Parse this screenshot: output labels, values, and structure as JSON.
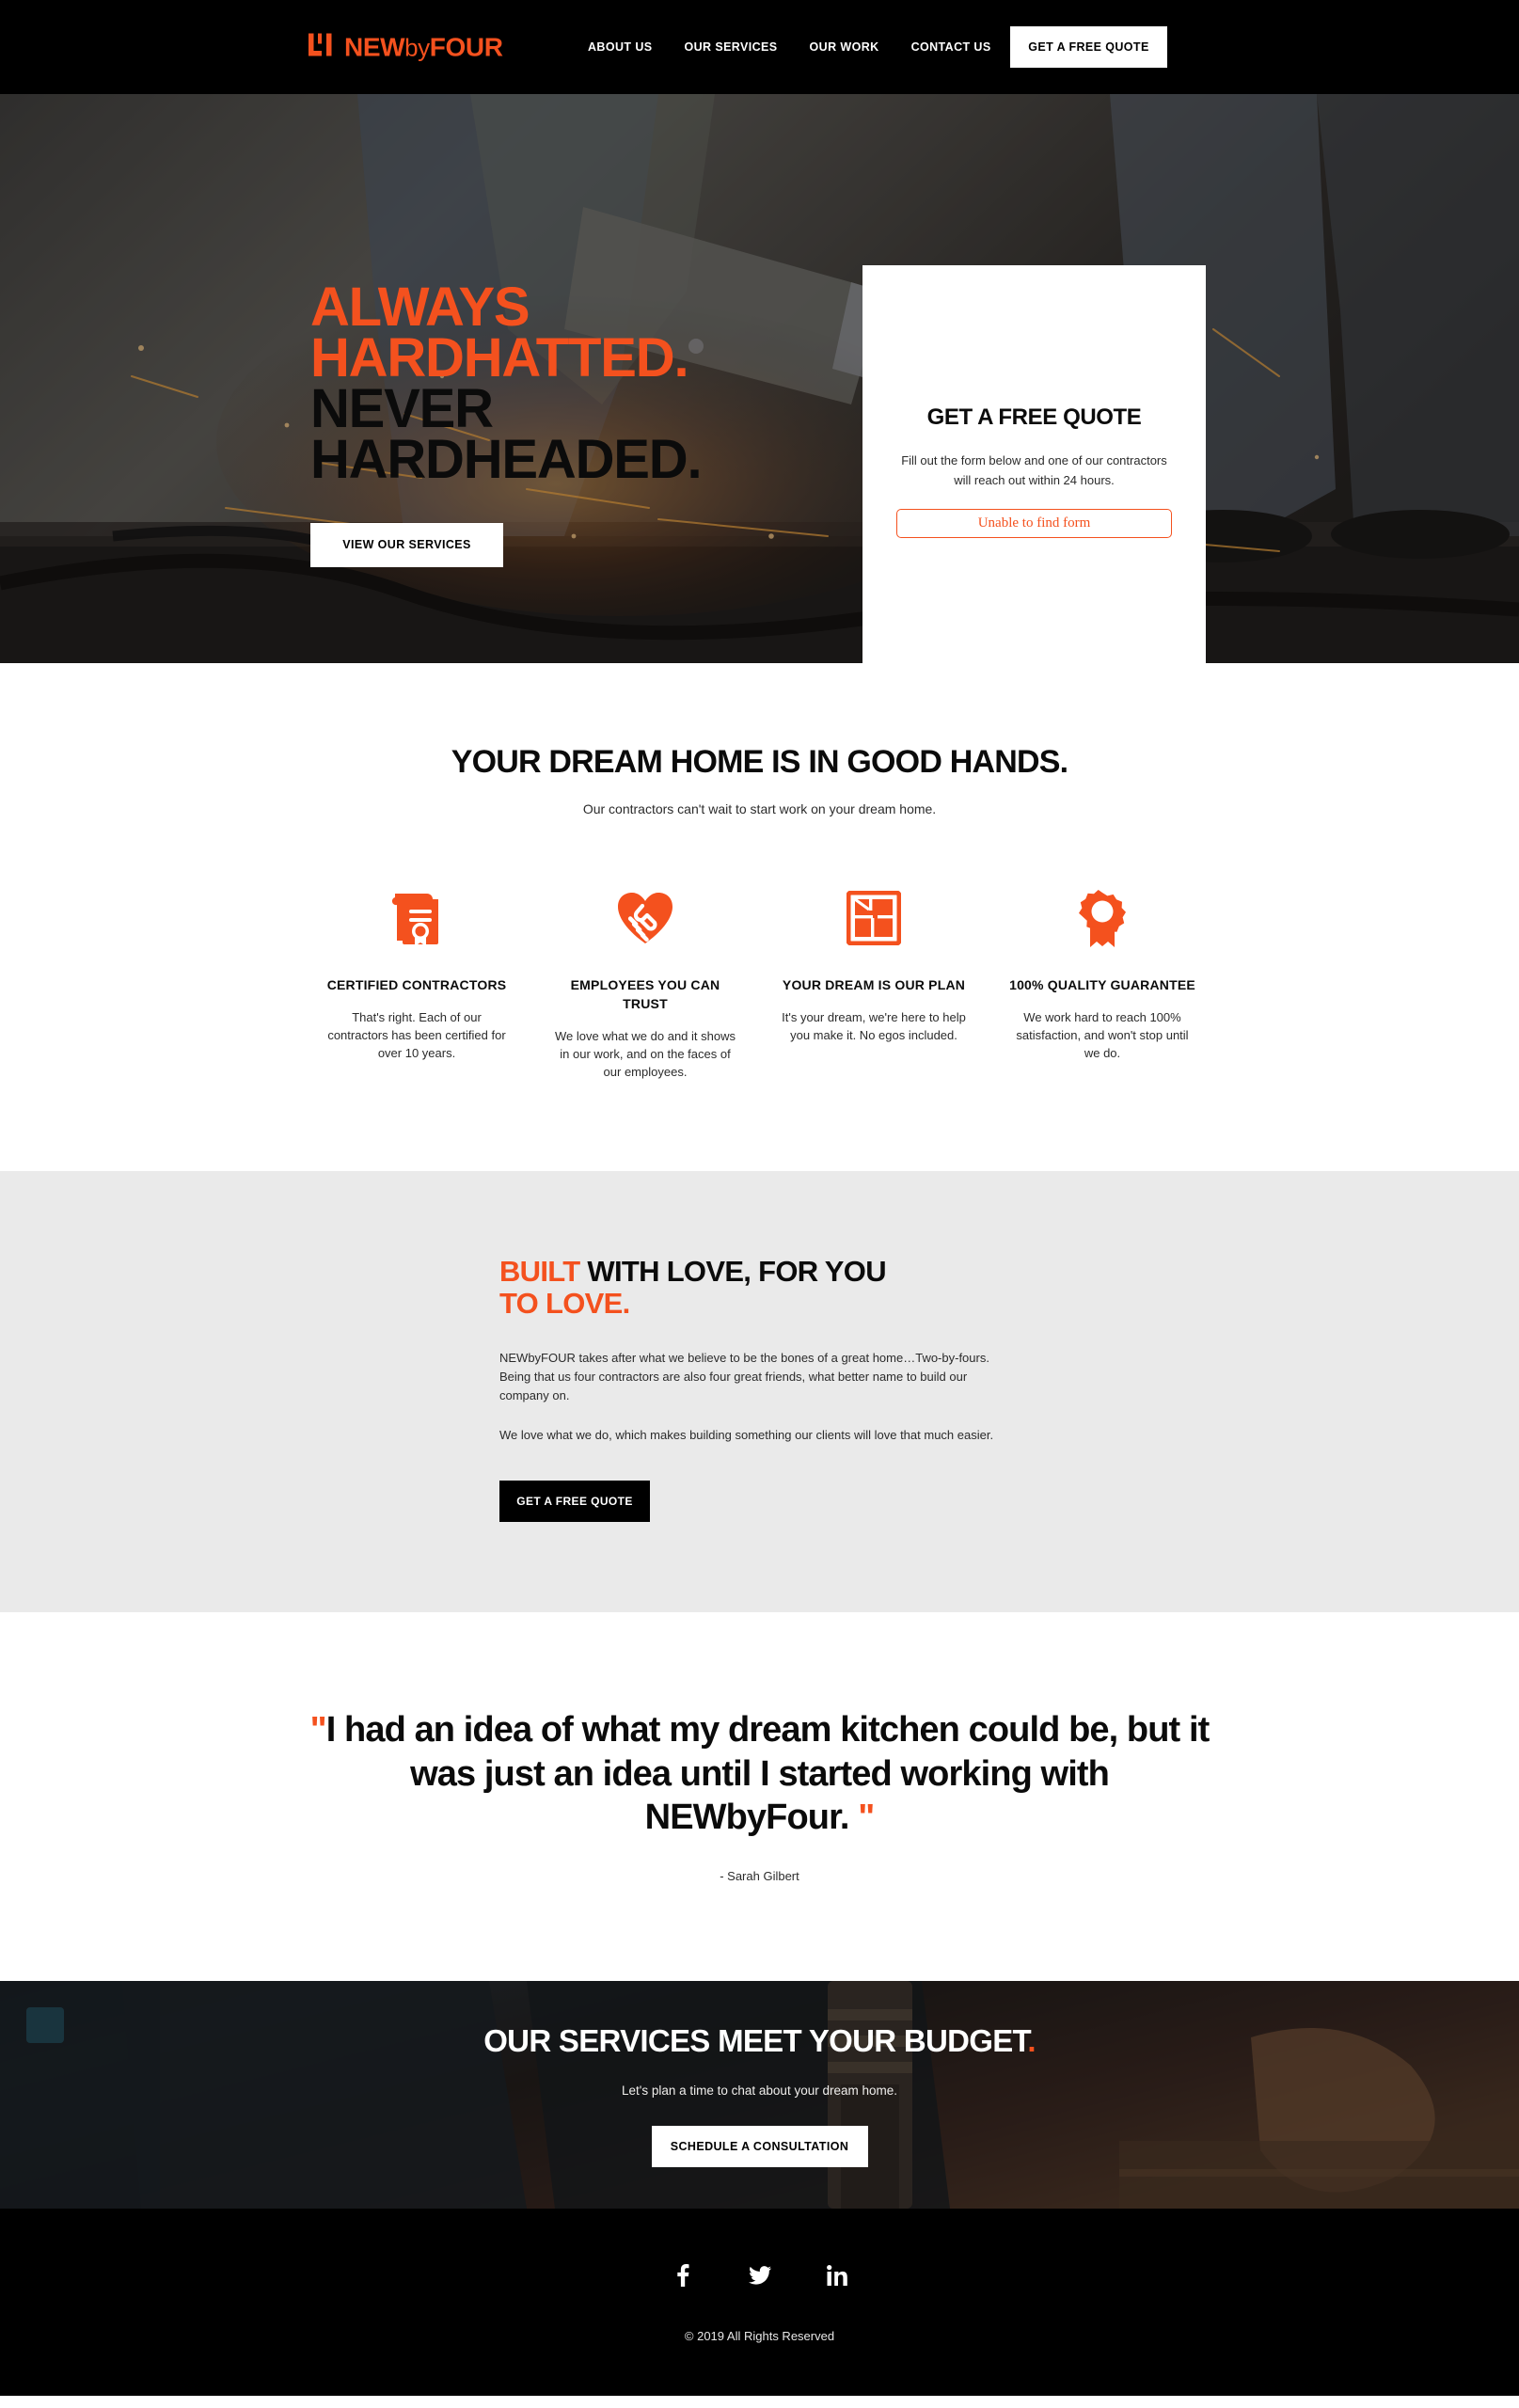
{
  "header": {
    "logo_text_main": "NEW",
    "logo_text_light": "by",
    "logo_text_end": "FOUR",
    "logo_icon": "newbyfour-mark-icon",
    "nav": [
      {
        "label": "ABOUT US"
      },
      {
        "label": "OUR SERVICES"
      },
      {
        "label": "OUR WORK"
      },
      {
        "label": "CONTACT US"
      }
    ],
    "cta_label": "GET A FREE QUOTE"
  },
  "hero": {
    "line1": "ALWAYS",
    "line2": "HARDHATTED.",
    "line3": "NEVER",
    "line4": "HARDHEADED.",
    "button_label": "VIEW OUR SERVICES",
    "form_card": {
      "title": "GET A FREE QUOTE",
      "description": "Fill out the form below and one of our contractors will reach out within 24 hours.",
      "error_label": "Unable to find form"
    }
  },
  "good_hands": {
    "title": "YOUR DREAM HOME IS IN GOOD HANDS.",
    "subtitle": "Our contractors can't wait to start work on your dream home.",
    "features": [
      {
        "icon": "certificate-icon",
        "heading": "CERTIFIED CONTRACTORS",
        "body": "That's right. Each of our contractors has been certified for over 10 years."
      },
      {
        "icon": "handshake-heart-icon",
        "heading": "EMPLOYEES YOU CAN TRUST",
        "body": "We love what we do and it shows in our work, and on the faces of our employees."
      },
      {
        "icon": "floorplan-icon",
        "heading": "YOUR DREAM IS OUR PLAN",
        "body": "It's your dream, we're here to help you make it. No egos included."
      },
      {
        "icon": "award-ribbon-icon",
        "heading": "100% QUALITY GUARANTEE",
        "body": "We work hard to reach 100% satisfaction, and won't stop until we do."
      }
    ]
  },
  "built": {
    "heading_highlight": "BUILT",
    "heading_rest": " WITH LOVE, FOR YOU",
    "heading_line2": "TO LOVE.",
    "paragraph1": "NEWbyFOUR takes after what we believe to be the bones of a great home…Two-by-fours. Being that us four contractors are also four great friends, what better name to build our company on.",
    "paragraph2": "We love what we do, which makes building something our clients will love that much easier.",
    "button_label": "GET A FREE QUOTE"
  },
  "testimonial": {
    "open_quote": "\"",
    "text": "I had an idea of what my dream kitchen could be, but it was just an idea until I started working with NEWbyFour. ",
    "close_quote": "\"",
    "attribution": "- Sarah Gilbert"
  },
  "budget": {
    "heading": "OUR SERVICES MEET YOUR BUDGET",
    "heading_dot": ".",
    "subtitle": "Let's plan a time to chat about your dream home.",
    "button_label": "SCHEDULE A CONSULTATION"
  },
  "footer": {
    "socials": [
      {
        "icon": "facebook-icon",
        "name": "Facebook"
      },
      {
        "icon": "twitter-icon",
        "name": "Twitter"
      },
      {
        "icon": "linkedin-icon",
        "name": "LinkedIn"
      }
    ],
    "copyright": "© 2019 All Rights Reserved"
  },
  "colors": {
    "accent": "#F4511E",
    "dark": "#000000",
    "light_gray": "#EAEAEA"
  }
}
